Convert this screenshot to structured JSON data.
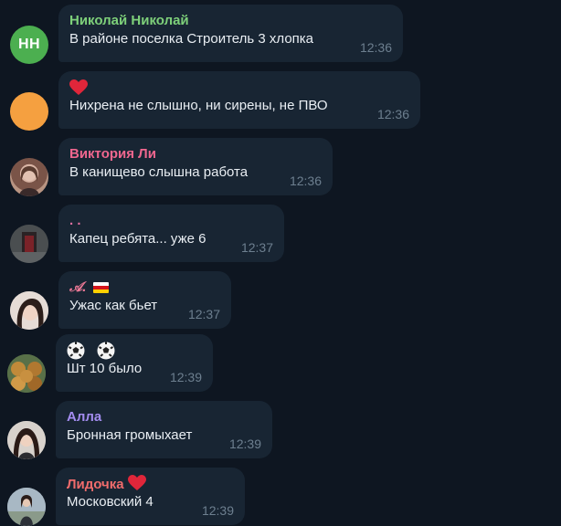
{
  "colors": {
    "background": "#0e1621",
    "bubble": "#182533",
    "message_text": "#e9eef3",
    "time_text": "#6d7f8f"
  },
  "messages": [
    {
      "sender": "Николай Николай",
      "sender_color": "#7ed07a",
      "avatar_initials": "НН",
      "avatar_color": "#4caf50",
      "text": "В районе поселка Строитель 3 хлопка",
      "time": "12:36"
    },
    {
      "sender": "",
      "reaction_icon": "heart-icon",
      "avatar_color": "#f5a040",
      "text": "Нихрена не слышно, ни сирены, не ПВО",
      "time": "12:36"
    },
    {
      "sender": "Виктория Ли",
      "sender_color": "#f0678f",
      "avatar_kind": "photo",
      "text": "В канищево слышна работа",
      "time": "12:36"
    },
    {
      "sender": ". .",
      "sender_color": "#e070a0",
      "avatar_kind": "photo",
      "text": "Капец ребята... уже 6",
      "time": "12:37"
    },
    {
      "sender": "𝒜.",
      "sender_color": "#f07a98",
      "sender_flag": "flag-icon",
      "avatar_kind": "photo",
      "text": "Ужас как бьет",
      "time": "12:37"
    },
    {
      "sender_icons": [
        "soccer-ball-icon",
        "soccer-ball-icon"
      ],
      "avatar_kind": "photo",
      "text": "Шт 10 было",
      "time": "12:39"
    },
    {
      "sender": "Алла",
      "sender_color": "#a48df0",
      "avatar_kind": "photo",
      "text": "Бронная громыхает",
      "time": "12:39"
    },
    {
      "sender": "Лидочка",
      "sender_color": "#f06c6c",
      "sender_icon": "heart-icon",
      "avatar_kind": "photo",
      "text": "Московский 4",
      "time": "12:39"
    }
  ]
}
